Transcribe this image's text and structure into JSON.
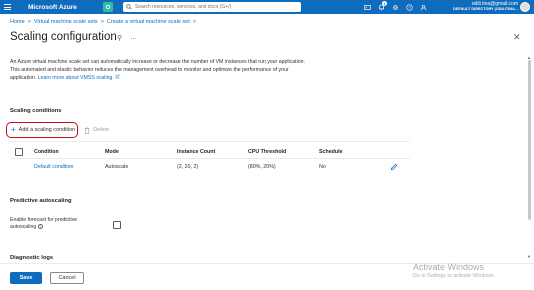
{
  "topbar": {
    "brand": "Microsoft Azure",
    "search_placeholder": "Search resources, services, and docs (G+/)",
    "notification_count": "1",
    "account_email": "odili.tina@gmail.com",
    "account_directory": "DEFAULT DIRECTORY (ODILITINA...",
    "icons": [
      "menu-icon",
      "copilot-icon",
      "cloud-shell-icon",
      "notifications-icon",
      "settings-icon",
      "help-icon",
      "feedback-icon"
    ]
  },
  "breadcrumb": {
    "items": [
      "Home",
      "Virtual machine scale sets",
      "Create a virtual machine scale set"
    ],
    "separator": ">"
  },
  "page": {
    "title": "Scaling configuration",
    "pin_glyph": "⚲",
    "more_glyph": "…",
    "close_glyph": "✕",
    "description": "An Azure virtual machine scale set can automatically increase or decrease the number of VM instances that run your application. This automated and elastic behavior reduces the management overhead to monitor and optimize the performance of your application.",
    "learn_more": "Learn more about VMSS scaling."
  },
  "scaling_conditions": {
    "heading": "Scaling conditions",
    "add_label": "Add a scaling condition",
    "delete_label": "Delete",
    "columns": [
      "Condition",
      "Mode",
      "Instance Count",
      "CPU Threshold",
      "Schedule"
    ],
    "rows": [
      {
        "condition": "Default condition",
        "mode": "Autoscale",
        "instance_count": "(2, 20, 2)",
        "cpu_threshold": "(80%, 20%)",
        "schedule": "No"
      }
    ]
  },
  "predictive_autoscaling": {
    "heading": "Predictive autoscaling",
    "label": "Enable forecast for predictive autoscaling",
    "enabled": false
  },
  "diagnostic_logs": {
    "heading": "Diagnostic logs"
  },
  "footer": {
    "save_label": "Save",
    "cancel_label": "Cancel"
  },
  "watermark": {
    "title": "Activate Windows",
    "subtitle": "Go to Settings to activate Windows."
  },
  "colors": {
    "accent": "#0f6cbd",
    "highlight_border": "#c50f1f"
  }
}
